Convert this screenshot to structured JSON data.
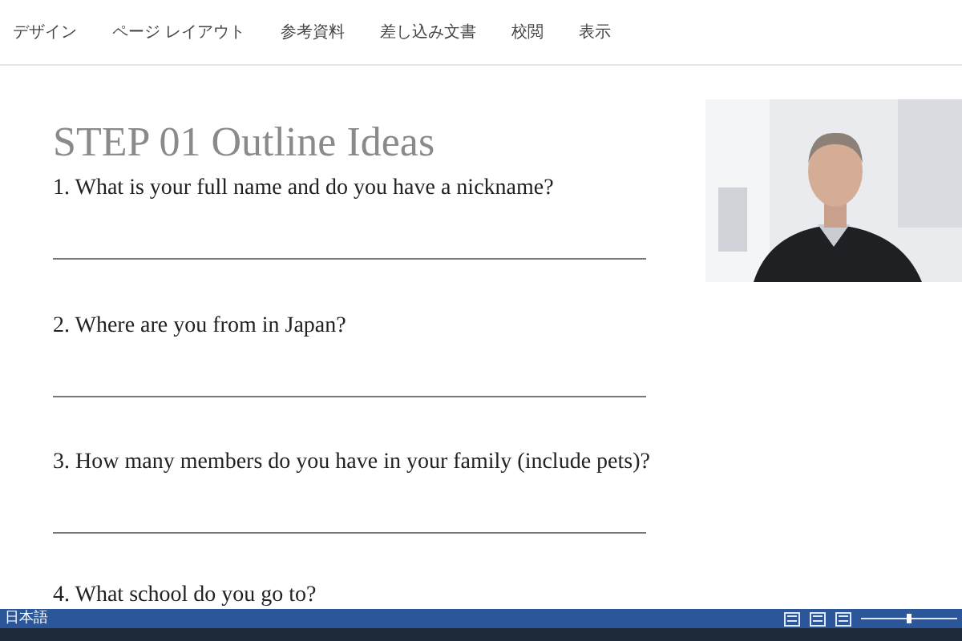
{
  "ribbon_tabs": [
    {
      "label": "デザイン"
    },
    {
      "label": "ページ レイアウト"
    },
    {
      "label": "参考資料"
    },
    {
      "label": "差し込み文書"
    },
    {
      "label": "校閲"
    },
    {
      "label": "表示"
    }
  ],
  "document": {
    "title": "STEP 01 Outline Ideas",
    "questions": [
      {
        "text": "1. What is your full name and do you have a nickname?"
      },
      {
        "text": "2. Where are you from in Japan?"
      },
      {
        "text": "3. How many members do you have in your family (include pets)?"
      },
      {
        "text": "4. What school do you go to?"
      }
    ]
  },
  "status_bar": {
    "language": "日本語",
    "zoom": {
      "level": 0.5
    }
  }
}
